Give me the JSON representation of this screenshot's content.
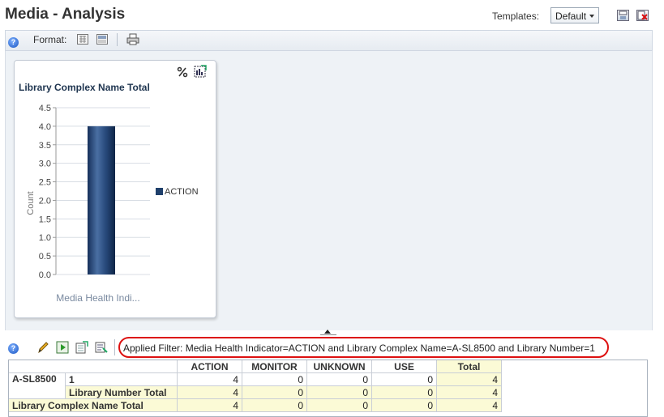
{
  "header": {
    "title": "Media - Analysis",
    "templates_label": "Templates:",
    "templates_selected": "Default"
  },
  "toolbar": {
    "format_label": "Format:"
  },
  "chart": {
    "title": "Library Complex Name Total"
  },
  "chart_data": {
    "type": "bar",
    "title": "Library Complex Name Total",
    "categories": [
      "ACTION"
    ],
    "series": [
      {
        "name": "ACTION",
        "values": [
          4
        ],
        "color": "#1f3f6b"
      }
    ],
    "xlabel": "Media Health Indi...",
    "ylabel": "Count",
    "ylim": [
      0,
      4.5
    ],
    "yticks": [
      "4.5",
      "4.0",
      "3.5",
      "3.0",
      "2.5",
      "2.0",
      "1.5",
      "1.0",
      "0.5",
      "0.0"
    ],
    "grid": true,
    "legend": "right"
  },
  "filter": {
    "text": "Applied Filter: Media Health Indicator=ACTION and Library Complex Name=A-SL8500 and Library Number=1"
  },
  "table": {
    "columns": [
      "ACTION",
      "MONITOR",
      "UNKNOWN",
      "USE",
      "Total"
    ],
    "rows": [
      {
        "label1": "A-SL8500",
        "label2": "1",
        "values": [
          "4",
          "0",
          "0",
          "0",
          "4"
        ]
      },
      {
        "label1": "",
        "label2": "Library Number Total",
        "values": [
          "4",
          "0",
          "0",
          "0",
          "4"
        ]
      },
      {
        "label1": "Library Complex Name Total",
        "label2": "",
        "values": [
          "4",
          "0",
          "0",
          "0",
          "4"
        ]
      }
    ]
  },
  "colors": {
    "accent": "#1f3f6b",
    "filter_highlight": "#dd1111",
    "total_bg": "#fbfad6"
  }
}
